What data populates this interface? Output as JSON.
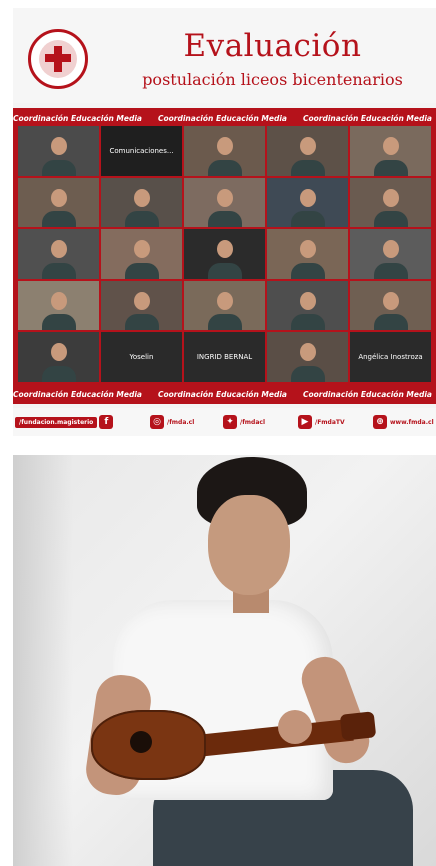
{
  "post1": {
    "header": {
      "title": "Evaluación",
      "subtitle": "postulación liceos bicentenarios",
      "logo_icon": "fmda-logo-icon"
    },
    "band_text": [
      "Coordinación Educación Media",
      "Coordinación Educación Media",
      "Coordinación Educación Media"
    ],
    "tiles": [
      {
        "label": "",
        "center": ""
      },
      {
        "label": "",
        "center": "Comunicaciones..."
      },
      {
        "label": "",
        "center": ""
      },
      {
        "label": "",
        "center": ""
      },
      {
        "label": "",
        "center": ""
      },
      {
        "label": "",
        "center": ""
      },
      {
        "label": "",
        "center": ""
      },
      {
        "label": "",
        "center": ""
      },
      {
        "label": "",
        "center": ""
      },
      {
        "label": "",
        "center": ""
      },
      {
        "label": "",
        "center": ""
      },
      {
        "label": "",
        "center": ""
      },
      {
        "label": "",
        "center": ""
      },
      {
        "label": "",
        "center": ""
      },
      {
        "label": "",
        "center": ""
      },
      {
        "label": "",
        "center": ""
      },
      {
        "label": "",
        "center": ""
      },
      {
        "label": "",
        "center": ""
      },
      {
        "label": "",
        "center": ""
      },
      {
        "label": "",
        "center": ""
      },
      {
        "label": "",
        "center": ""
      },
      {
        "label": "",
        "center": "Yoselin"
      },
      {
        "label": "",
        "center": "INGRID BERNAL"
      },
      {
        "label": "",
        "center": ""
      },
      {
        "label": "",
        "center": "Angélica Inostroza"
      }
    ],
    "social": [
      {
        "icon": "facebook-icon",
        "label": "/fundacion.magisterio",
        "glyph": "f"
      },
      {
        "icon": "instagram-icon",
        "label": "/fmda.cl",
        "glyph": "◎"
      },
      {
        "icon": "twitter-icon",
        "label": "/fmdacl",
        "glyph": "✦"
      },
      {
        "icon": "youtube-icon",
        "label": "/FmdaTV",
        "glyph": "▶"
      },
      {
        "icon": "web-icon",
        "label": "www.fmda.cl",
        "glyph": "⊕"
      }
    ]
  },
  "post2": {
    "photo_subject": "boy-playing-ukulele"
  },
  "colors": {
    "brand_red": "#b5121b"
  }
}
